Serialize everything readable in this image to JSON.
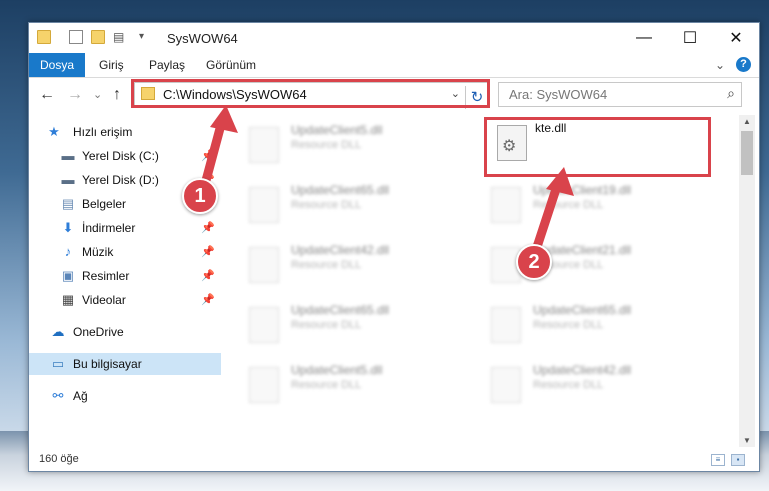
{
  "window": {
    "title": "SysWOW64",
    "controls": {
      "minimize": "—",
      "maximize": "☐",
      "close": "✕"
    }
  },
  "ribbon": {
    "tabs": [
      "Dosya",
      "Giriş",
      "Paylaş",
      "Görünüm"
    ],
    "expand": "⌄",
    "help": "?"
  },
  "nav": {
    "back": "←",
    "forward": "→",
    "recent": "⌄",
    "up": "↑"
  },
  "address": {
    "path": "C:\\Windows\\SysWOW64",
    "dropdown": "⌄",
    "refresh": "↻"
  },
  "search": {
    "placeholder": "Ara: SysWOW64",
    "icon": "⌕"
  },
  "sidebar": {
    "items": [
      {
        "label": "Hızlı erişim",
        "icon": "★",
        "icon_color": "#2f7ed8"
      },
      {
        "label": "Yerel Disk (C:)",
        "icon": "▬",
        "icon_color": "#5a6f87",
        "pin": "📌"
      },
      {
        "label": "Yerel Disk (D:)",
        "icon": "▬",
        "icon_color": "#5a6f87",
        "pin": "📌"
      },
      {
        "label": "Belgeler",
        "icon": "▤",
        "icon_color": "#6b8db5",
        "pin": "📌"
      },
      {
        "label": "İndirmeler",
        "icon": "⬇",
        "icon_color": "#2f7ed8",
        "pin": "📌"
      },
      {
        "label": "Müzik",
        "icon": "♪",
        "icon_color": "#2f7ed8",
        "pin": "📌"
      },
      {
        "label": "Resimler",
        "icon": "▣",
        "icon_color": "#5a85b8",
        "pin": "📌"
      },
      {
        "label": "Videolar",
        "icon": "▦",
        "icon_color": "#444444",
        "pin": "📌"
      },
      {
        "label": "OneDrive",
        "icon": "☁",
        "icon_color": "#1f6fc1"
      },
      {
        "label": "Bu bilgisayar",
        "icon": "▭",
        "icon_color": "#3c7fc0"
      },
      {
        "label": "Ağ",
        "icon": "⚯",
        "icon_color": "#2f7ed8"
      }
    ]
  },
  "files": [
    {
      "name": "UpdateClient5.dll",
      "type": "Resource DLL"
    },
    {
      "name": "UpdateClient65.dll",
      "type": "Resource DLL"
    },
    {
      "name": "UpdateClient19.dll",
      "type": "Resource DLL"
    },
    {
      "name": "UpdateClient42.dll",
      "type": "Resource DLL"
    },
    {
      "name": "UpdateClient21.dll",
      "type": "Resource DLL"
    },
    {
      "name": "UpdateClient65.dll",
      "type": "Resource DLL"
    },
    {
      "name": "UpdateClient65.dll",
      "type": "Resource DLL"
    },
    {
      "name": "UpdateClient5.dll",
      "type": "Resource DLL"
    },
    {
      "name": "UpdateClient42.dll",
      "type": "Resource DLL"
    }
  ],
  "highlighted_file": {
    "name": "kte.dll",
    "icon": "⚙"
  },
  "status": {
    "count": "160 öğe"
  },
  "callouts": [
    "1",
    "2"
  ],
  "colors": {
    "accent": "#1979ca",
    "highlight": "#d9434b"
  }
}
